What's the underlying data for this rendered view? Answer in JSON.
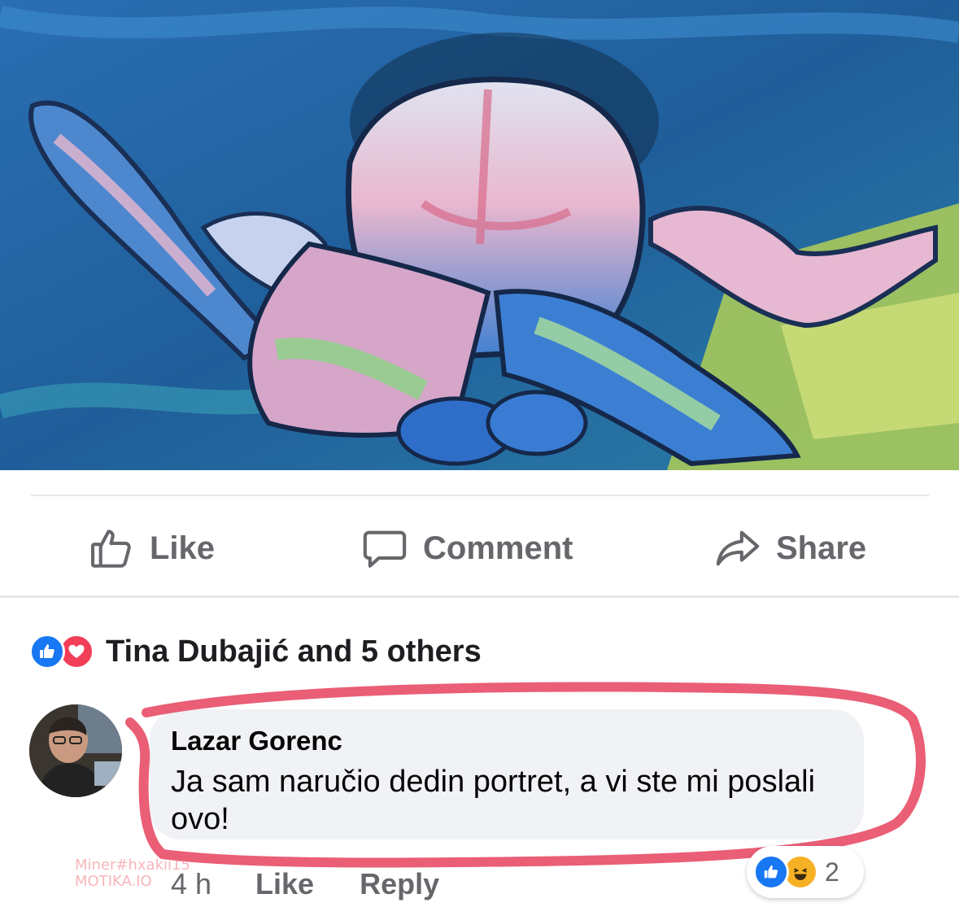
{
  "actions": {
    "like_label": "Like",
    "comment_label": "Comment",
    "share_label": "Share",
    "like_icon": "thumbs-up-outline",
    "comment_icon": "speech-bubble-outline",
    "share_icon": "share-arrow-outline"
  },
  "reactions": {
    "summary": "Tina Dubajić and 5 others",
    "icons": [
      "like-reaction",
      "love-reaction"
    ],
    "like_color": "#1877f2",
    "love_color": "#f33e58"
  },
  "comment": {
    "author": "Lazar Gorenc",
    "text": "Ja sam naručio dedin portret, a vi ste mi poslali ovo!",
    "time": "4 h",
    "like_label": "Like",
    "reply_label": "Reply",
    "reaction_count": "2",
    "reaction_icons": [
      "like-reaction",
      "haha-reaction"
    ],
    "highlight_color": "#e8506a"
  },
  "watermark": {
    "line1": "Miner#hxakii15",
    "line2": "MOTIKA.IO"
  }
}
